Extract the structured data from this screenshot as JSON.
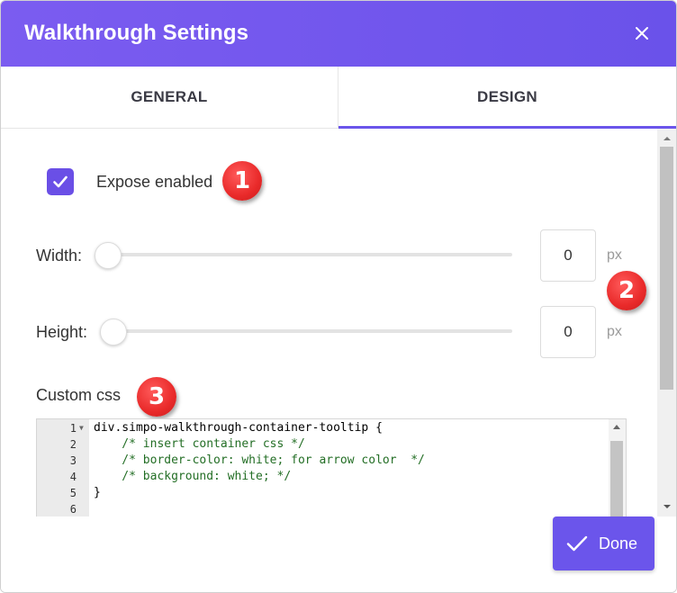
{
  "dialog": {
    "title": "Walkthrough Settings",
    "close_icon": "close-icon"
  },
  "tabs": [
    {
      "label": "GENERAL",
      "active": false
    },
    {
      "label": "DESIGN",
      "active": true
    }
  ],
  "design": {
    "expose": {
      "label": "Expose enabled",
      "checked": true
    },
    "width": {
      "label": "Width:",
      "value": "0",
      "unit": "px",
      "slider_fraction": 0
    },
    "height": {
      "label": "Height:",
      "value": "0",
      "unit": "px",
      "slider_fraction": 0
    },
    "custom_css": {
      "label": "Custom css",
      "lines": [
        {
          "num": "1",
          "text": "div.simpo-walkthrough-container-tooltip {",
          "type": "code",
          "fold": true
        },
        {
          "num": "2",
          "text": "    /* insert container css */",
          "type": "comment",
          "fold": false
        },
        {
          "num": "3",
          "text": "    /* border-color: white; for arrow color  */",
          "type": "comment",
          "fold": false
        },
        {
          "num": "4",
          "text": "    /* background: white; */",
          "type": "comment",
          "fold": false
        },
        {
          "num": "5",
          "text": "}",
          "type": "code",
          "fold": false
        },
        {
          "num": "6",
          "text": "",
          "type": "code",
          "fold": false
        }
      ]
    }
  },
  "annotations": [
    "1",
    "2",
    "3"
  ],
  "footer": {
    "done_label": "Done",
    "done_icon": "check-icon"
  },
  "colors": {
    "accent": "#6b55eb",
    "header": "#7b5cf0",
    "badge": "#e92a2a",
    "comment": "#236e25"
  }
}
